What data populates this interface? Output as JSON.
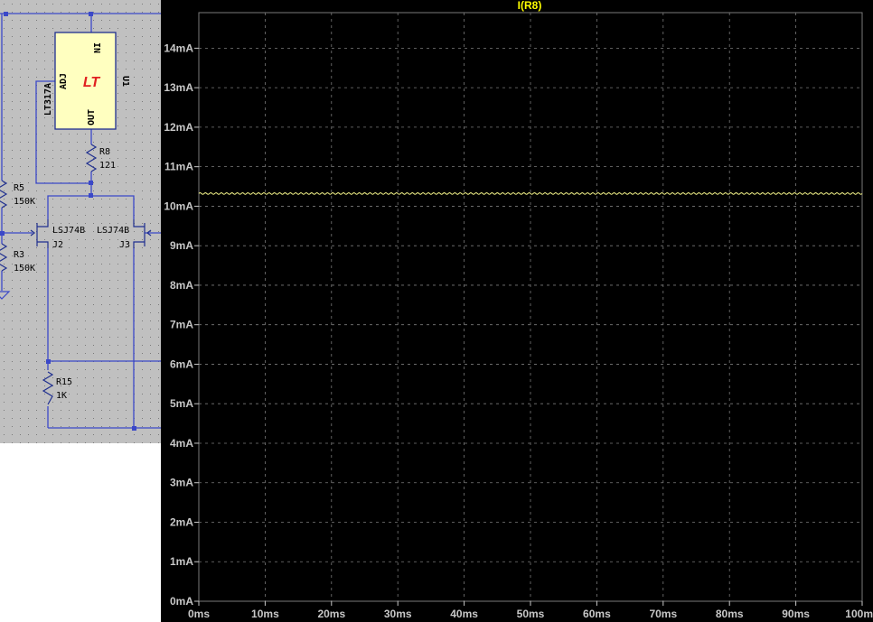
{
  "schematic": {
    "u1": {
      "ref": "U1",
      "part": "LT317A",
      "pins": {
        "in": "IN",
        "adj": "ADJ",
        "out": "OUT"
      },
      "logo": "LT"
    },
    "r8": {
      "ref": "R8",
      "value": "121"
    },
    "r5": {
      "ref": "R5",
      "value": "150K"
    },
    "r3": {
      "ref": "R3",
      "value": "150K"
    },
    "r15": {
      "ref": "R15",
      "value": "1K"
    },
    "j2": {
      "ref": "J2",
      "part": "LSJ74B"
    },
    "j3": {
      "ref": "J3",
      "part": "LSJ74B"
    },
    "colors": {
      "sheet": "#c0c0c0",
      "wire": "#3b48c8",
      "component": "#1f2f8f",
      "symbol_fill": "#ffffc0",
      "logo": "#e02020"
    }
  },
  "plot": {
    "colors": {
      "background": "#000000",
      "grid": "#7a7a7a",
      "trace": "#f5f58a",
      "title": "#ffff00",
      "labels": "#c8c8c8"
    },
    "grid": true,
    "chart_data": {
      "type": "line",
      "title": "I(R8)",
      "xlabel": "",
      "ylabel": "",
      "x_ticks": [
        "0ms",
        "10ms",
        "20ms",
        "30ms",
        "40ms",
        "50ms",
        "60ms",
        "70ms",
        "80ms",
        "90ms",
        "100m"
      ],
      "y_ticks": [
        "0mA",
        "1mA",
        "2mA",
        "3mA",
        "4mA",
        "5mA",
        "6mA",
        "7mA",
        "8mA",
        "9mA",
        "10mA",
        "11mA",
        "12mA",
        "13mA",
        "14mA"
      ],
      "xlim": [
        0,
        100
      ],
      "ylim": [
        0,
        14.9
      ],
      "series": [
        {
          "name": "I(R8)",
          "x": [
            0,
            100
          ],
          "y": [
            10.32,
            10.32
          ],
          "ripple_mA": 0.02,
          "ripple_period_ms": 0.8
        }
      ]
    }
  }
}
